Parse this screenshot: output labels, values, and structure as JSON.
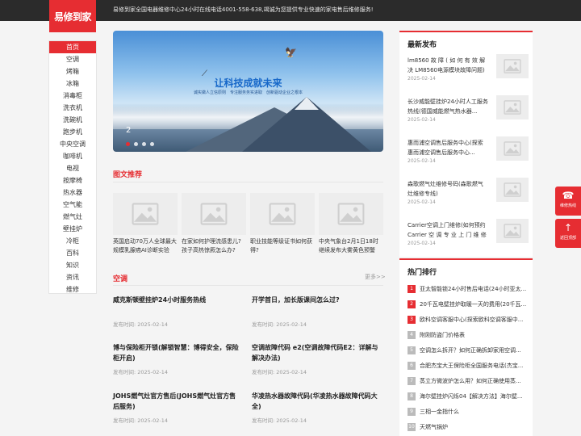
{
  "logo": "易修到家",
  "topbar": {
    "message": "易修到家全国电器维修中心24小时在线电话4001-558-638,竭诚为您提供专业快速的家电售后维修服务!"
  },
  "nav": [
    "首页",
    "空调",
    "烤箱",
    "冰箱",
    "消毒柜",
    "洗衣机",
    "洗碗机",
    "跑步机",
    "中央空调",
    "咖啡机",
    "电视",
    "按摩椅",
    "热水器",
    "空气能",
    "燃气灶",
    "壁挂炉",
    "冷柜",
    "百科",
    "知识",
    "资讯",
    "维修"
  ],
  "banner": {
    "title": "让科技成就未来",
    "subtitle": "诚实做人立信原则　专注服务务实进取　创新驱动企业之根本",
    "slide_number": "2",
    "dots": 4,
    "active_dot": 0
  },
  "featured": {
    "heading": "图文推荐",
    "items": [
      "英国启动70万人全球最大规模乳腺癌AI诊断实验",
      "在家如何护理流感患儿?孩子高热惊厥怎么办?",
      "职业技能等级证书如何获得?",
      "中央气象台2月1日18时继续发布大雾黄色预警"
    ]
  },
  "aircon": {
    "heading": "空调",
    "more": "更多>>",
    "date_prefix": "发布时间: ",
    "news": [
      {
        "title": "威克斯顿壁挂炉24小时服务热线",
        "date": "2025-02-14"
      },
      {
        "title": "开学首日，加长版课间怎么过?",
        "date": "2025-02-14"
      },
      {
        "title": "博与保险柜开锁(解锁智慧：博得安全，保险柜开启)",
        "date": "2025-02-14"
      },
      {
        "title": "空调故障代码 e2(空调故障代码E2：详解与解决办法)",
        "date": "2025-02-14"
      },
      {
        "title": "JOHS燃气灶官方售后(JOHS燃气灶官方售后服务)",
        "date": "2025-02-14"
      },
      {
        "title": "华凌热水器故障代码(华凌热水器故障代码大全)",
        "date": "2025-02-14"
      }
    ]
  },
  "latest": {
    "heading": "最新发布",
    "items": [
      {
        "title": "lm8560 故 障 ( 如 何 有 效 解 决 LM8560电源模块故障问题)",
        "date": "2025-02-14"
      },
      {
        "title": "长沙威能壁挂炉24小时人工服务热线(德国威能燃气热水器...",
        "date": "2025-02-14"
      },
      {
        "title": "惠而浦空调售后服务中心(探索惠而浦空调售后服务中心...",
        "date": "2025-02-14"
      },
      {
        "title": "森歌燃气灶维修号码(森歌燃气灶维修专线)",
        "date": "2025-02-14"
      },
      {
        "title": "Carrier空调上门维修(如何预约Carrier 空 调 专 业 上 门 维 修 服...",
        "date": "2025-02-14"
      }
    ]
  },
  "ranking": {
    "heading": "热门排行",
    "items": [
      "亚太智能锁24小时售后电话(24小时亚太...",
      "20千瓦电壁挂炉取暖一天的费用(20千瓦...",
      "欧科空调客服中心(探索欧科空调客服中...",
      "附刚防盗门价格表",
      "空调怎么拆开？如何正确拆卸家用空调...",
      "合肥杰宝大王保险柜全国服务电话(杰宝...",
      "蒸立方微波炉怎么用？如何正确使用蒸...",
      "海尔壁挂炉闪烁04【解决方法】海尔壁...",
      "三相一金指什么",
      "天燃气锅炉"
    ]
  },
  "float": {
    "hotline_label": "维修热线",
    "top_label": "返回顶部"
  },
  "colors": {
    "accent": "#e62d32",
    "topbar": "#2b2b2b"
  }
}
